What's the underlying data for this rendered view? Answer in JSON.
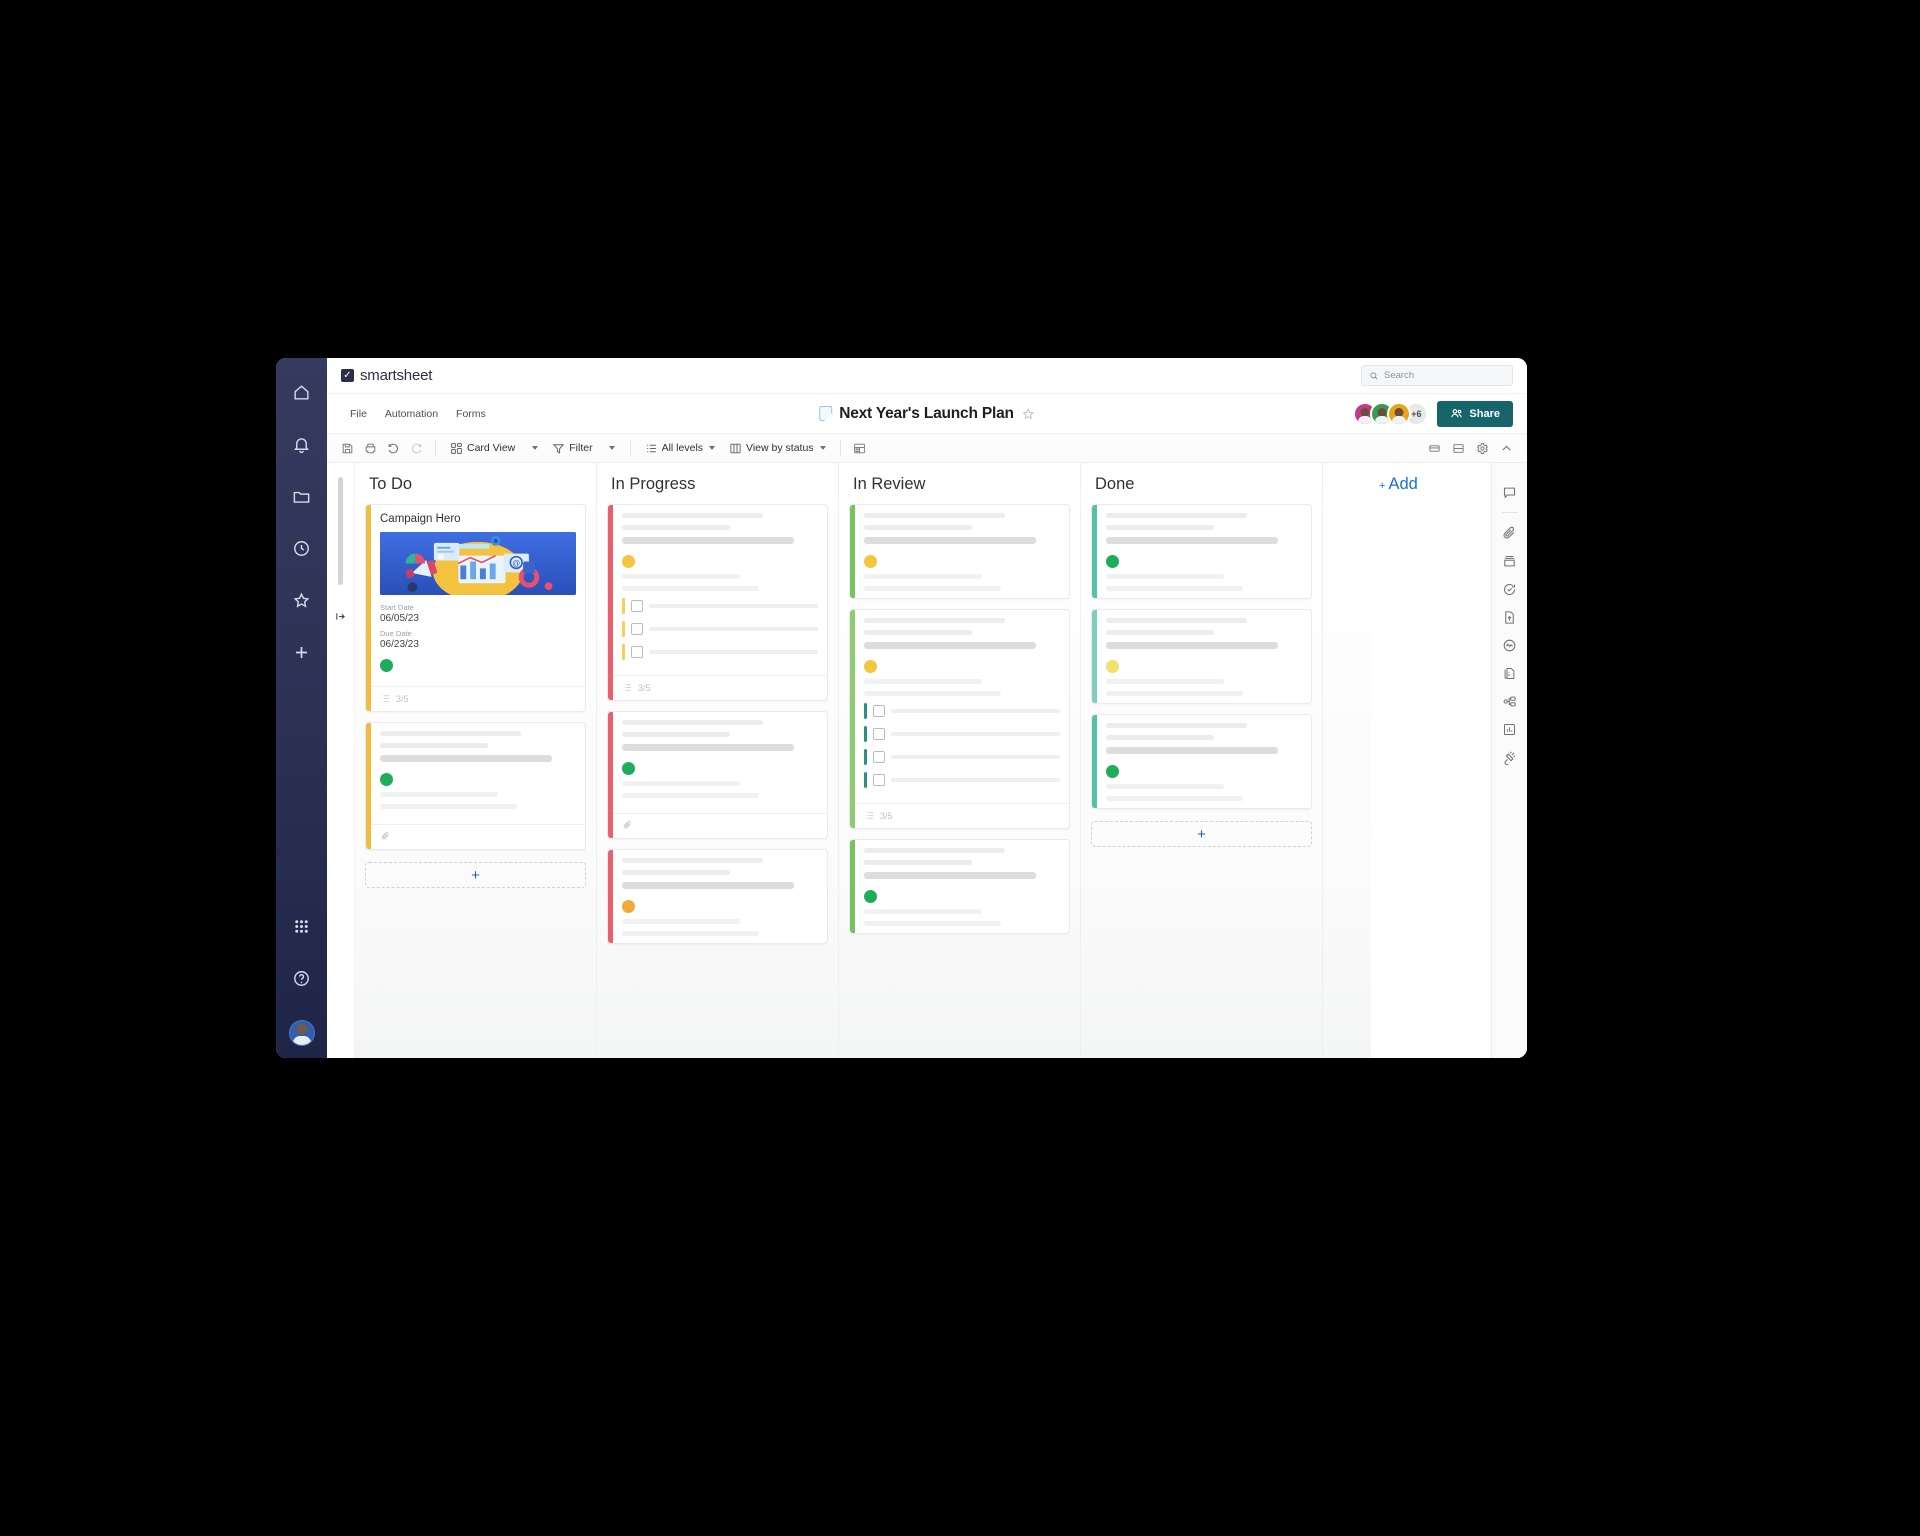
{
  "app": {
    "brand_name": "smartsheet",
    "brand_mark_icon": "checkbox-mark-icon"
  },
  "search": {
    "placeholder": "Search",
    "value": "",
    "icon": "search-icon"
  },
  "left_rail": {
    "items": [
      {
        "name": "home",
        "icon": "home-icon"
      },
      {
        "name": "notifications",
        "icon": "bell-icon"
      },
      {
        "name": "browse",
        "icon": "folder-icon"
      },
      {
        "name": "recents",
        "icon": "clock-icon"
      },
      {
        "name": "favorites",
        "icon": "star-icon"
      },
      {
        "name": "create",
        "icon": "plus-icon"
      }
    ],
    "bottom_items": [
      {
        "name": "app-switcher",
        "icon": "grid-apps-icon"
      },
      {
        "name": "help",
        "icon": "question-circle-icon"
      },
      {
        "name": "account-avatar",
        "icon": "user-avatar"
      }
    ]
  },
  "menubar": {
    "items": [
      {
        "label": "File"
      },
      {
        "label": "Automation"
      },
      {
        "label": "Forms"
      }
    ]
  },
  "sheet": {
    "title": "Next Year's Launch Plan",
    "icon": "sheet-icon",
    "favorite_icon": "star-outline-icon",
    "is_favorite": false
  },
  "collaborators": {
    "overflow_label": "+6",
    "avatar_colors": [
      "#c43a86",
      "#3a9a4e",
      "#e8a516"
    ]
  },
  "share": {
    "label": "Share",
    "icon": "people-icon",
    "color": "#15656b"
  },
  "toolbar": {
    "left_icons": [
      {
        "name": "save",
        "icon": "save-icon"
      },
      {
        "name": "print",
        "icon": "print-icon"
      },
      {
        "name": "undo",
        "icon": "undo-icon"
      },
      {
        "name": "redo",
        "icon": "redo-icon"
      }
    ],
    "groups": [
      {
        "name": "view-mode",
        "label": "Card View",
        "icon": "card-view-icon",
        "has_caret": true
      },
      {
        "name": "filter",
        "label": "Filter",
        "icon": "filter-icon",
        "has_caret": true
      },
      {
        "name": "levels",
        "label": "All levels",
        "icon": "levels-icon",
        "has_caret": true
      },
      {
        "name": "view-by",
        "label": "View by status",
        "icon": "columns-icon",
        "has_caret": true
      }
    ],
    "trailing_icon": {
      "name": "card-layout",
      "icon": "card-layout-icon"
    },
    "right_icons": [
      {
        "name": "row-height",
        "icon": "row-single-icon"
      },
      {
        "name": "split-view",
        "icon": "row-split-icon"
      },
      {
        "name": "settings",
        "icon": "gear-icon"
      },
      {
        "name": "collapse-toolbar",
        "icon": "chevron-up-icon"
      }
    ]
  },
  "board": {
    "add_column_label": "Add",
    "add_column_plus": "+",
    "add_card_symbol": "+",
    "columns": [
      {
        "title": "To Do",
        "stripe_color": "#f3bc3f",
        "has_add_card": true,
        "cards": [
          {
            "type": "detailed",
            "title": "Campaign Hero",
            "stripe_color": "#f3bc3f",
            "has_thumbnail": true,
            "fields": [
              {
                "label": "Start Date",
                "value": "06/05/23"
              },
              {
                "label": "Due Date",
                "value": "06/23/23"
              }
            ],
            "status_dot_color": "#1eae5b",
            "footer": {
              "icon": "checklist-icon",
              "count": "3/5"
            }
          },
          {
            "type": "skeleton",
            "stripe_color": "#f3bc3f",
            "status_dot_color": "#1eae5b",
            "footer": {
              "icon": "paperclip-icon",
              "count": ""
            }
          }
        ]
      },
      {
        "title": "In Progress",
        "stripe_color": "#ea5f6b",
        "has_add_card": false,
        "cards": [
          {
            "type": "skeleton-subtasks",
            "stripe_color": "#ea5f6b",
            "status_dot_color": "#f5c53d",
            "subtask_bar_color": "#f3cf56",
            "subtask_count": 3,
            "footer": {
              "icon": "checklist-icon",
              "count": "3/5"
            }
          },
          {
            "type": "skeleton",
            "stripe_color": "#ea5f6b",
            "status_dot_color": "#1eae5b",
            "footer": {
              "icon": "paperclip-icon",
              "count": ""
            }
          },
          {
            "type": "skeleton",
            "stripe_color": "#ea5f6b",
            "status_dot_color": "#f0a93a",
            "footer": {
              "icon": "",
              "count": ""
            }
          }
        ]
      },
      {
        "title": "In Review",
        "stripe_color": "#76c461",
        "has_add_card": false,
        "cards": [
          {
            "type": "skeleton",
            "stripe_color": "#76c461",
            "status_dot_color": "#f5c53d",
            "footer": {
              "icon": "",
              "count": ""
            }
          },
          {
            "type": "skeleton-subtasks",
            "stripe_color": "#8ccd72",
            "status_dot_color": "#f5c53d",
            "subtask_bar_color": "#2f8f86",
            "subtask_count": 4,
            "footer": {
              "icon": "checklist-icon",
              "count": "3/5"
            }
          },
          {
            "type": "skeleton",
            "stripe_color": "#76c461",
            "status_dot_color": "#1eae5b",
            "footer": {
              "icon": "",
              "count": ""
            }
          }
        ]
      },
      {
        "title": "Done",
        "stripe_color": "#57bfa8",
        "has_add_card": true,
        "cards": [
          {
            "type": "skeleton",
            "stripe_color": "#57bfa8",
            "status_dot_color": "#1eae5b",
            "footer": {
              "icon": "",
              "count": ""
            }
          },
          {
            "type": "skeleton",
            "stripe_color": "#7dcfbb",
            "status_dot_color": "#f3e06a",
            "footer": {
              "icon": "",
              "count": ""
            }
          },
          {
            "type": "skeleton",
            "stripe_color": "#57bfa8",
            "status_dot_color": "#1eae5b",
            "footer": {
              "icon": "",
              "count": ""
            }
          }
        ]
      }
    ]
  },
  "right_rail": {
    "items": [
      {
        "name": "conversations",
        "icon": "comment-icon"
      },
      {
        "name": "attachments",
        "icon": "paperclip-icon"
      },
      {
        "name": "archive",
        "icon": "archive-icon"
      },
      {
        "name": "update-requests",
        "icon": "refresh-check-icon"
      },
      {
        "name": "publish",
        "icon": "file-upload-icon"
      },
      {
        "name": "activity-log",
        "icon": "activity-pulse-icon"
      },
      {
        "name": "proofs",
        "icon": "proof-document-icon"
      },
      {
        "name": "summary",
        "icon": "hierarchy-icon"
      },
      {
        "name": "reports",
        "icon": "bar-chart-icon"
      },
      {
        "name": "connectors",
        "icon": "plug-icon"
      }
    ]
  },
  "gutter": {
    "collapse_icon": "collapse-right-icon"
  }
}
